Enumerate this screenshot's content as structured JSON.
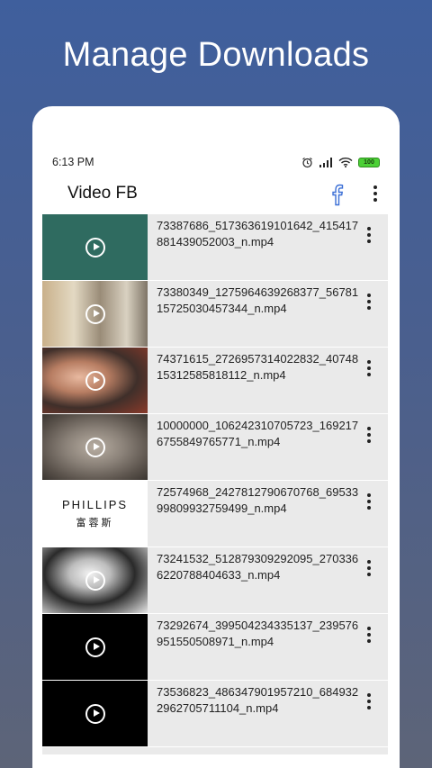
{
  "headline": "Manage Downloads",
  "status": {
    "time": "6:13 PM",
    "battery": "100"
  },
  "app": {
    "title": "Video FB"
  },
  "videos": [
    {
      "filename": "73387686_517363619101642_415417881439052003_n.mp4",
      "thumb": "teal"
    },
    {
      "filename": "73380349_1275964639268377_5678115725030457344_n.mp4",
      "thumb": "office"
    },
    {
      "filename": "74371615_2726957314022832_4074815312585818112_n.mp4",
      "thumb": "face"
    },
    {
      "filename": "10000000_106242310705723_1692176755849765771_n.mp4",
      "thumb": "cat"
    },
    {
      "filename": "72574968_2427812790670768_6953399809932759499_n.mp4",
      "thumb": "phillips",
      "brand": "PHILLIPS",
      "sub": "富蓉斯"
    },
    {
      "filename": "73241532_512879309292095_2703366220788404633_n.mp4",
      "thumb": "bw"
    },
    {
      "filename": "73292674_399504234335137_239576951550508971_n.mp4",
      "thumb": "black"
    },
    {
      "filename": "73536823_486347901957210_6849322962705711104_n.mp4",
      "thumb": "black"
    }
  ]
}
